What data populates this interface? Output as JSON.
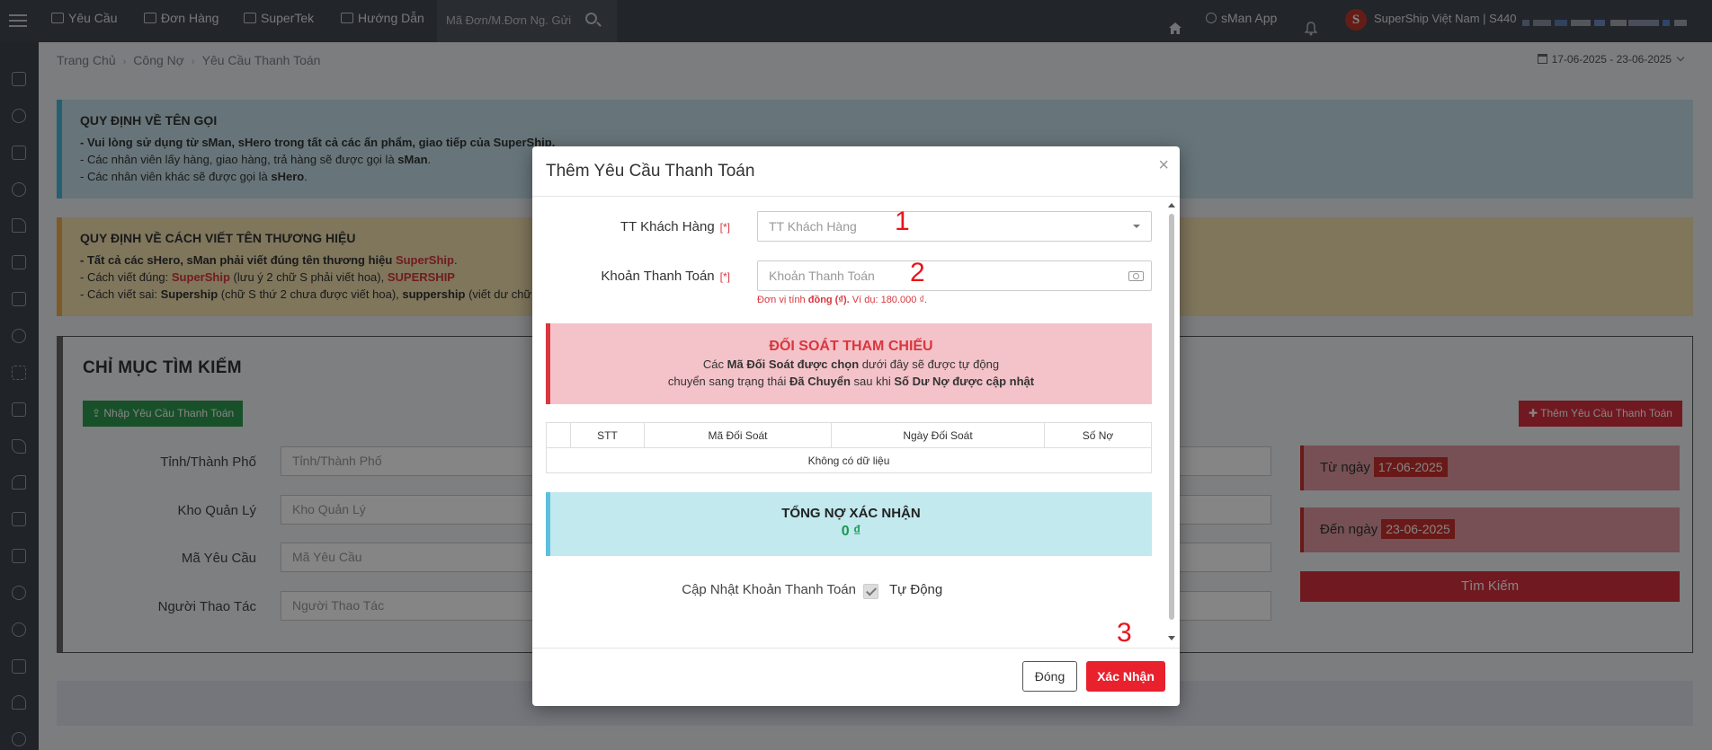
{
  "topbar": {
    "nav": [
      {
        "label": "Yêu Cầu",
        "icon": "chat-icon"
      },
      {
        "label": "Đơn Hàng",
        "icon": "clipboard-icon"
      },
      {
        "label": "SuperTek",
        "icon": "edit-icon"
      },
      {
        "label": "Hướng Dẫn",
        "icon": "book-icon"
      }
    ],
    "search_placeholder": "Mã Đơn/M.Đơn Ng. Gửi",
    "app_label": "sMan App",
    "account_label": "SuperShip Việt Nam | S440"
  },
  "breadcrumb": {
    "items": [
      "Trang Chủ",
      "Công Nợ",
      "Yêu Cầu Thanh Toán"
    ]
  },
  "date_range": "17-06-2025 - 23-06-2025",
  "notice_naming": {
    "title": "QUY ĐỊNH VỀ TÊN GỌI",
    "line1": "- Vui lòng sử dụng từ sMan, sHero trong tất cả các ấn phẩm, giao tiếp của SuperShip.",
    "line2_a": "- Các nhân viên lấy hàng, giao hàng, trả hàng sẽ được gọi là ",
    "line2_b": "sMan",
    "line3_a": "- Các nhân viên khác sẽ được gọi là ",
    "line3_b": "sHero"
  },
  "notice_brand": {
    "title": "QUY ĐỊNH VỀ CÁCH VIẾT TÊN THƯƠNG HIỆU",
    "line1_a": "- Tất cả các sHero, sMan phải viết đúng tên thương hiệu ",
    "line1_b": "SuperShip",
    "line2_a": "- Cách viết đúng: ",
    "line2_b": "SuperShip",
    "line2_c": " (lưu ý 2 chữ S phải viết hoa), ",
    "line2_d": "SUPERSHIP",
    "line3_a": "- Cách viết sai: ",
    "line3_b": "Supership",
    "line3_c": " (chữ S thứ 2 chưa được viết hoa), ",
    "line3_d": "suppership",
    "line3_e": " (viết dư chữ"
  },
  "search_panel": {
    "title": "CHỈ MỤC TÌM KIẾM",
    "import_button": "Nhập Yêu Cầu Thanh Toán",
    "add_button": "Thêm Yêu Cầu Thanh Toán",
    "fields": [
      {
        "label": "Tỉnh/Thành Phố",
        "placeholder": "Tỉnh/Thành Phố"
      },
      {
        "label": "Kho Quản Lý",
        "placeholder": "Kho Quản Lý"
      },
      {
        "label": "Mã Yêu Cầu",
        "placeholder": "Mã Yêu Cầu"
      },
      {
        "label": "Người Thao Tác",
        "placeholder": "Người Thao Tác"
      }
    ],
    "from_label": "Từ ngày",
    "from_value": "17-06-2025",
    "to_label": "Đến ngày",
    "to_value": "23-06-2025",
    "search_button": "Tìm Kiếm"
  },
  "modal": {
    "title": "Thêm Yêu Cầu Thanh Toán",
    "close_symbol": "×",
    "customer_label": "TT Khách Hàng",
    "customer_placeholder": "TT Khách Hàng",
    "amount_label": "Khoản Thanh Toán",
    "amount_placeholder": "Khoản Thanh Toán",
    "required_mark": "[*]",
    "hint_a": "Đơn vị tính ",
    "hint_b": "đồng (₫).",
    "hint_c": " Ví dụ: 180.000 ₫.",
    "reconcile": {
      "title": "ĐỐI SOÁT THAM CHIẾU",
      "line1_a": "Các ",
      "line1_b": "Mã Đối Soát được chọn",
      "line1_c": " dưới đây sẽ được tự động",
      "line2_a": "chuyển sang trạng thái ",
      "line2_b": "Đã Chuyển",
      "line2_c": " sau khi ",
      "line2_d": "Số Dư Nợ được cập nhật"
    },
    "table": {
      "columns": [
        "",
        "STT",
        "Mã Đối Soát",
        "Ngày Đối Soát",
        "Số Nợ"
      ],
      "empty_text": "Không có dữ liệu"
    },
    "total": {
      "title": "TỔNG NỢ XÁC NHẬN",
      "value": "0 ₫"
    },
    "auto_update_label": "Cập Nhật Khoản Thanh Toán",
    "auto_update_text": "Tự Động",
    "auto_update_checked": true,
    "close_button": "Đóng",
    "confirm_button": "Xác Nhận",
    "annotations": [
      "1",
      "2",
      "3"
    ]
  },
  "colors": {
    "accent_red": "#d6313f",
    "success_green": "#2e9a4f",
    "topbar": "#42474f"
  }
}
